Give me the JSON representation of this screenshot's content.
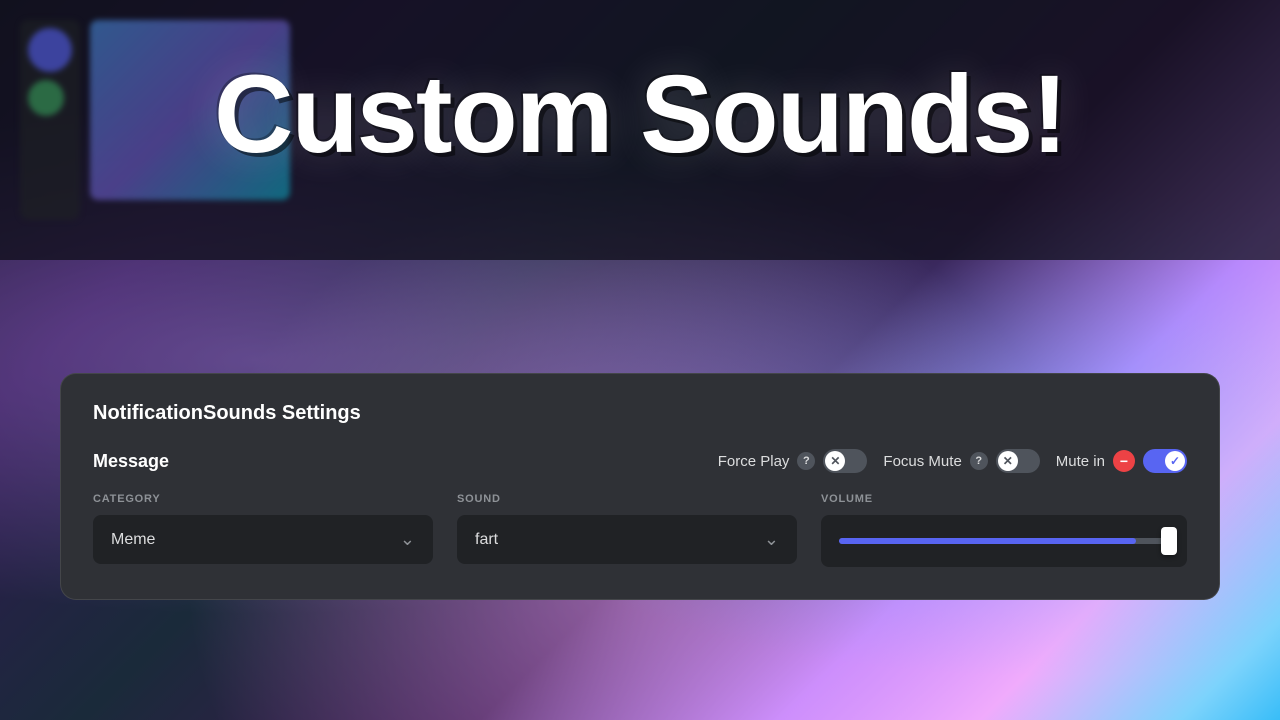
{
  "background": {
    "title": "Custom Sounds!"
  },
  "panel": {
    "title": "NotificationSounds Settings",
    "message_label": "Message",
    "force_play_label": "Force Play",
    "focus_mute_label": "Focus Mute",
    "mute_in_label": "Mute in",
    "force_play_state": "off",
    "focus_mute_state": "off",
    "mute_in_state": "on",
    "category_label": "CATEGORY",
    "sound_label": "SOUND",
    "volume_label": "VOLUME",
    "category_value": "Meme",
    "sound_value": "fart",
    "volume_percent": 90,
    "help_icon_label": "?",
    "minus_icon": "−",
    "check_icon": "✓",
    "x_icon": "✕"
  }
}
